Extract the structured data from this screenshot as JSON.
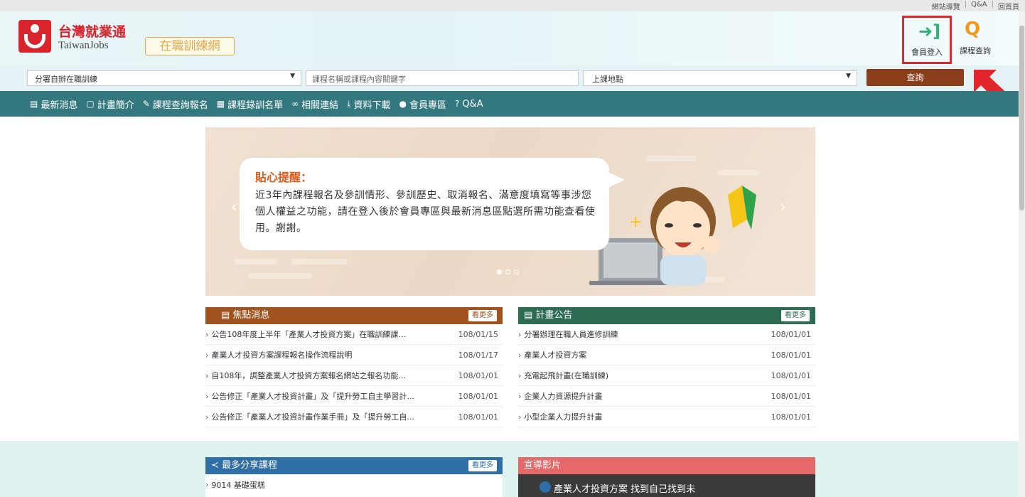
{
  "toplinks": [
    "網站導覽",
    "Q&A",
    "回首頁"
  ],
  "brand": {
    "name_cn": "台灣就業通",
    "name_en": "TaiwanJobs",
    "subtitle": "在職訓練網"
  },
  "header_actions": {
    "login": "會員登入",
    "course_query": "課程查詢"
  },
  "search": {
    "category_selected": "分署自辦在職訓練",
    "keyword_placeholder": "課程名稱或課程內容關鍵字",
    "location_selected": "上課地點",
    "submit": "查詢"
  },
  "nav": [
    {
      "icon": "news-icon",
      "label": "最新消息"
    },
    {
      "icon": "clipboard-icon",
      "label": "計畫簡介"
    },
    {
      "icon": "pencil-icon",
      "label": "課程查詢報名"
    },
    {
      "icon": "list-icon",
      "label": "課程錄訓名單"
    },
    {
      "icon": "link-icon",
      "label": "相關連結"
    },
    {
      "icon": "download-icon",
      "label": "資料下載"
    },
    {
      "icon": "user-icon",
      "label": "會員專區"
    },
    {
      "icon": "question-icon",
      "label": "Q&A"
    }
  ],
  "banner": {
    "title": "貼心提醒：",
    "text": "近3年內課程報名及參訓情形、參訓歷史、取消報名、滿意度填寫等事涉您個人權益之功能，請在登入後於會員專區與最新消息區點選所需功能查看使用。謝謝。"
  },
  "focus_news": {
    "title": "焦點消息",
    "more": "看更多",
    "items": [
      {
        "title": "公告108年度上半年「產業人才投資方案」在職訓練課...",
        "date": "108/01/15"
      },
      {
        "title": "產業人才投資方案課程報名操作流程說明",
        "date": "108/01/17"
      },
      {
        "title": "自108年，調整產業人才投資方案報名網站之報名功能...",
        "date": "108/01/01"
      },
      {
        "title": "公告修正「產業人才投資計畫」及「提升勞工自主學習計...",
        "date": "108/01/01"
      },
      {
        "title": "公告修正「產業人才投資計畫作業手冊」及「提升勞工自...",
        "date": "108/01/01"
      }
    ]
  },
  "plan_notice": {
    "title": "計畫公告",
    "more": "看更多",
    "items": [
      {
        "title": "分署辦理在職人員進修訓練",
        "date": "108/01/01"
      },
      {
        "title": "產業人才投資方案",
        "date": "108/01/01"
      },
      {
        "title": "充電起飛計畫(在職訓練)",
        "date": "108/01/01"
      },
      {
        "title": "企業人力資源提升計畫",
        "date": "108/01/01"
      },
      {
        "title": "小型企業人力提升計畫",
        "date": "108/01/01"
      }
    ]
  },
  "shared_courses": {
    "title": "最多分享課程",
    "more": "看更多",
    "first_item": "9014 基礎蛋糕"
  },
  "video": {
    "title": "宣導影片",
    "caption": "產業人才投資方案 找到自己找到未"
  },
  "colors": {
    "nav": "#33787f",
    "focus_head": "#a0521f",
    "plan_head": "#2e6b53",
    "shared_head": "#2f6ea6",
    "video_head": "#e6696a",
    "accent_red": "#e3262c"
  }
}
